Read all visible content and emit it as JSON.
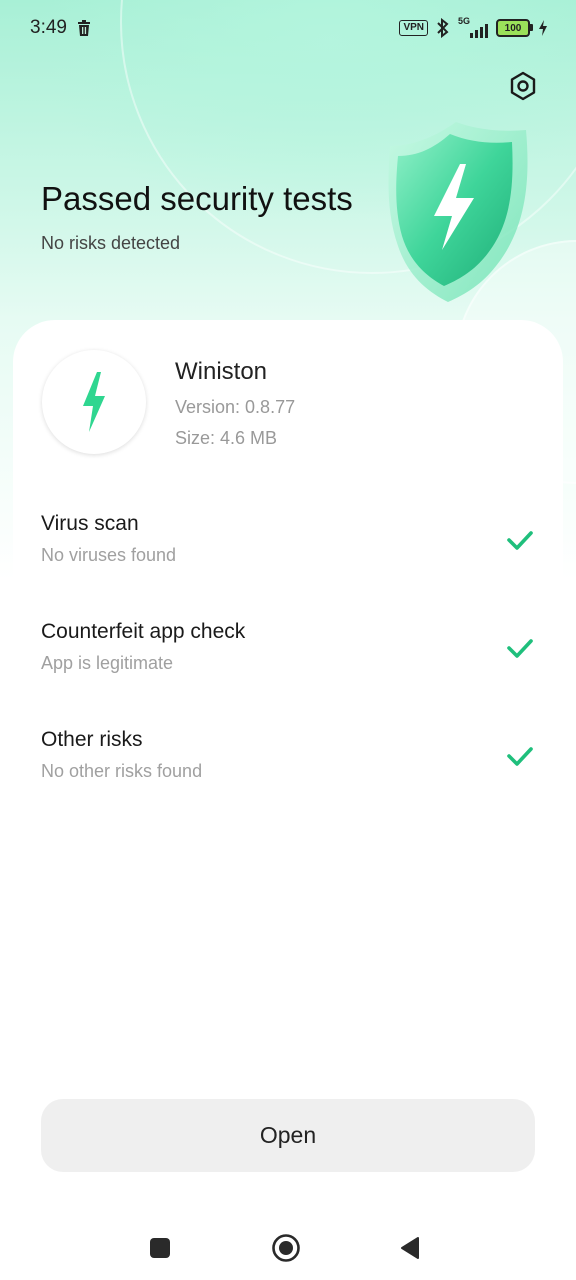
{
  "status_bar": {
    "time": "3:49",
    "vpn_label": "VPN",
    "network_label": "5G",
    "battery_level": "100"
  },
  "hero": {
    "title": "Passed security tests",
    "subtitle": "No risks detected"
  },
  "app": {
    "name": "Winiston",
    "version": "Version: 0.8.77",
    "size": "Size: 4.6 MB"
  },
  "checks": [
    {
      "title": "Virus scan",
      "result": "No viruses found",
      "passed": true
    },
    {
      "title": "Counterfeit app check",
      "result": "App is legitimate",
      "passed": true
    },
    {
      "title": "Other risks",
      "result": "No other risks found",
      "passed": true
    }
  ],
  "actions": {
    "open_label": "Open"
  },
  "colors": {
    "accent": "#1fbf7c",
    "hero_top": "#a8f0d6",
    "button_bg": "#efefef"
  },
  "icons": {
    "settings": "settings-hex-icon",
    "trash": "trash-icon",
    "bluetooth": "bluetooth-icon",
    "signal": "signal-icon",
    "charging": "charging-bolt-icon",
    "check": "check-icon",
    "nav_recents": "square-icon",
    "nav_home": "circle-icon",
    "nav_back": "triangle-back-icon"
  }
}
